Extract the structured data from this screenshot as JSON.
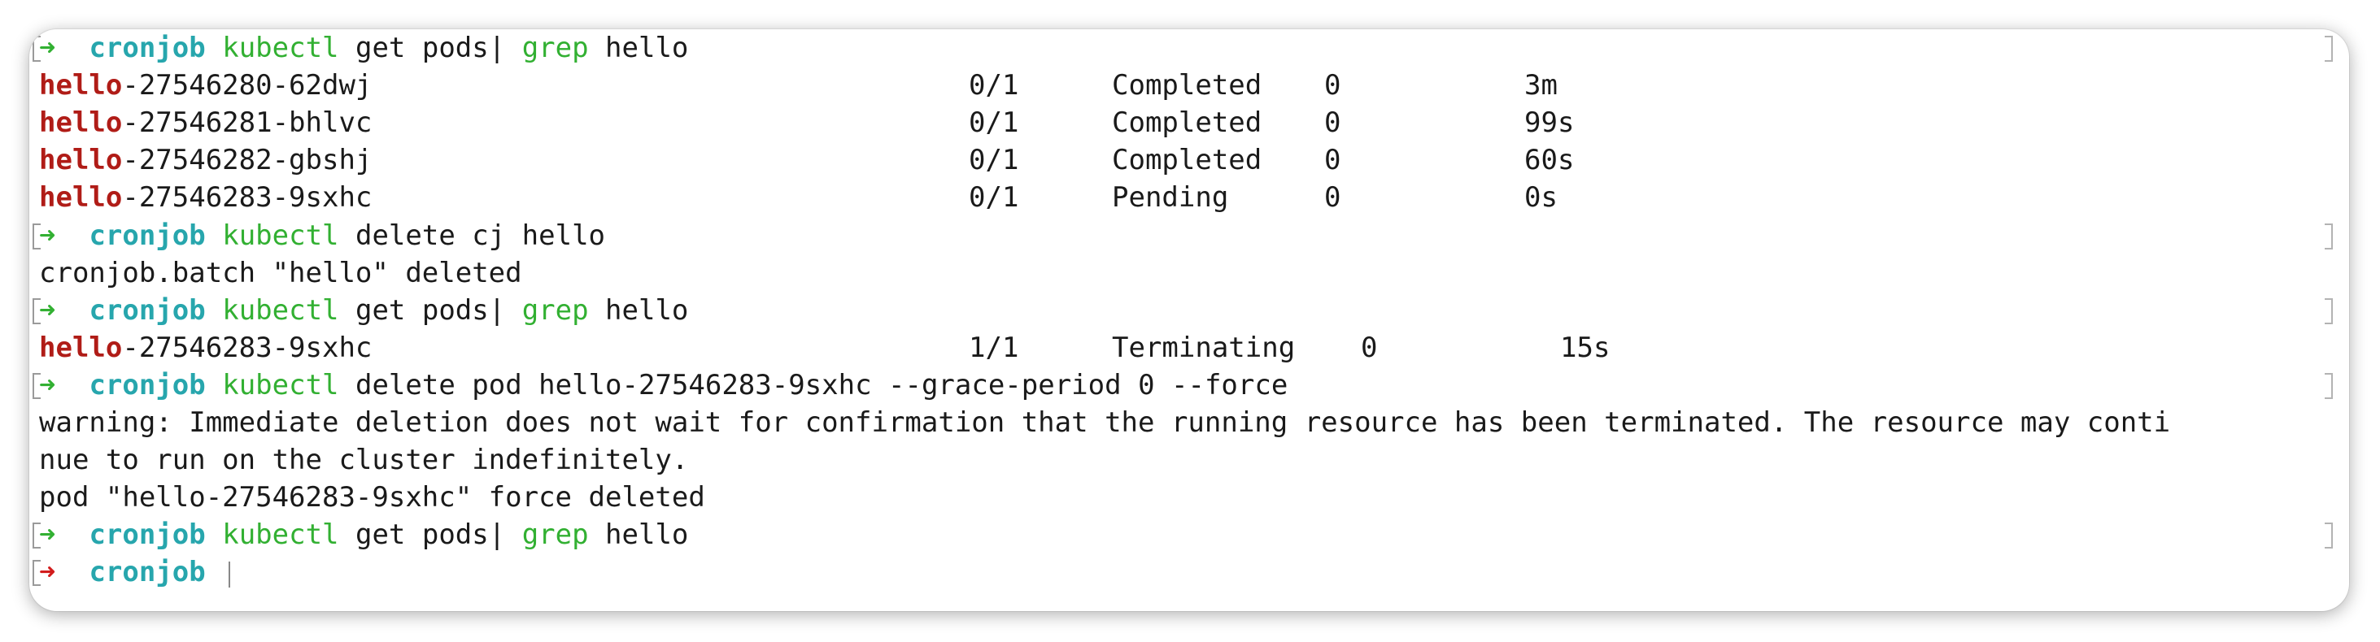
{
  "prompt": {
    "arrow": "➜",
    "dir": "cronjob"
  },
  "lines": [
    {
      "type": "prompt",
      "cmd1": "kubectl",
      "rest1": " get pods| ",
      "cmd2": "grep",
      "rest2": " hello"
    },
    {
      "type": "pod",
      "prefix": "hello",
      "suffix": "-27546280-62dwj",
      "ready": "0/1",
      "status": "Completed",
      "restarts": "0",
      "age": "3m"
    },
    {
      "type": "pod",
      "prefix": "hello",
      "suffix": "-27546281-bhlvc",
      "ready": "0/1",
      "status": "Completed",
      "restarts": "0",
      "age": "99s"
    },
    {
      "type": "pod",
      "prefix": "hello",
      "suffix": "-27546282-gbshj",
      "ready": "0/1",
      "status": "Completed",
      "restarts": "0",
      "age": "60s"
    },
    {
      "type": "pod",
      "prefix": "hello",
      "suffix": "-27546283-9sxhc",
      "ready": "0/1",
      "status": "Pending",
      "restarts": "0",
      "age": "0s"
    },
    {
      "type": "prompt",
      "cmd1": "kubectl",
      "rest1": " delete cj hello"
    },
    {
      "type": "output",
      "text": "cronjob.batch \"hello\" deleted"
    },
    {
      "type": "prompt",
      "cmd1": "kubectl",
      "rest1": " get pods| ",
      "cmd2": "grep",
      "rest2": " hello"
    },
    {
      "type": "pod",
      "prefix": "hello",
      "suffix": "-27546283-9sxhc",
      "ready": "1/1",
      "status": "Terminating",
      "restarts": "0",
      "age": "15s"
    },
    {
      "type": "prompt",
      "cmd1": "kubectl",
      "rest1": " delete pod hello-27546283-9sxhc --grace-period 0 --force"
    },
    {
      "type": "output",
      "text": "warning: Immediate deletion does not wait for confirmation that the running resource has been terminated. The resource may conti"
    },
    {
      "type": "output",
      "text": "nue to run on the cluster indefinitely."
    },
    {
      "type": "output",
      "text": "pod \"hello-27546283-9sxhc\" force deleted"
    },
    {
      "type": "prompt",
      "cmd1": "kubectl",
      "rest1": " get pods| ",
      "cmd2": "grep",
      "rest2": " hello"
    },
    {
      "type": "active-prompt"
    }
  ],
  "colors": {
    "arrow_ok": "#32b032",
    "arrow_err": "#d21c1c",
    "directory": "#27a6ad",
    "command": "#32b032",
    "grep_match": "#b01c17",
    "text": "#1a1a1a"
  }
}
